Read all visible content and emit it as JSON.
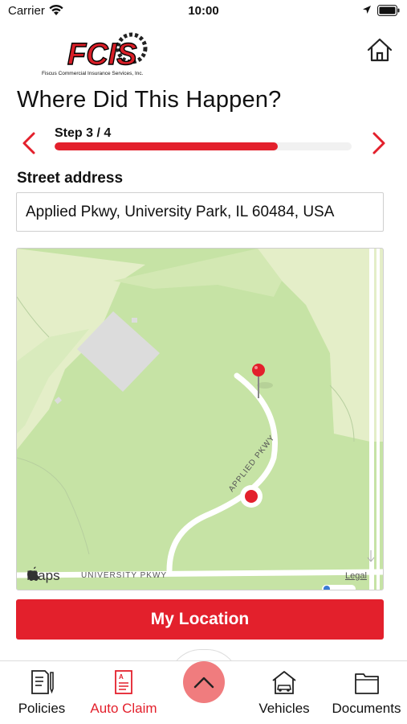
{
  "status_bar": {
    "carrier": "Carrier",
    "time": "10:00"
  },
  "header": {
    "logo_text": "FCIS",
    "logo_subtitle": "Fiscus Commercial Insurance Services, Inc.",
    "home_icon": "home-icon"
  },
  "page": {
    "title": "Where Did This Happen?"
  },
  "stepper": {
    "label": "Step 3 / 4",
    "progress": 0.75,
    "prev_icon": "chevron-left-icon",
    "next_icon": "chevron-right-icon"
  },
  "address": {
    "label": "Street address",
    "value": "Applied Pkwy, University Park, IL 60484, USA"
  },
  "map": {
    "brand": "Maps",
    "legal": "Legal",
    "street_1": "UNIVERSITY PKWY",
    "street_2": "APPLIED PKWY"
  },
  "actions": {
    "my_location": "My Location"
  },
  "tabs": [
    {
      "label": "Policies",
      "icon": "policies-icon",
      "active": false
    },
    {
      "label": "Auto Claim",
      "icon": "auto-claim-icon",
      "active": true
    },
    {
      "label": "Vehicles",
      "icon": "vehicles-icon",
      "active": false
    },
    {
      "label": "Documents",
      "icon": "documents-icon",
      "active": false
    }
  ],
  "fab": {
    "icon": "chevron-up-icon"
  },
  "colors": {
    "accent": "#e3202c",
    "fab": "#f07c7e",
    "map_land": "#e4eec8",
    "map_park": "#c6e3a5"
  }
}
